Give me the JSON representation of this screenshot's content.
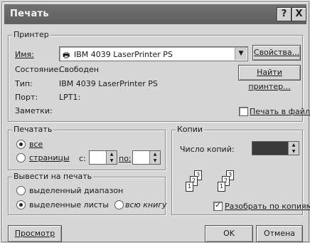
{
  "window": {
    "title": "Печать",
    "help_glyph": "?",
    "close_glyph": "X"
  },
  "printer": {
    "group_title": "Принтер",
    "name_label": "Имя:",
    "name_value": "IBM 4039 LaserPrinter PS",
    "properties_button": "Свойства...",
    "state_label": "Состояние:",
    "state_value": "Свободен",
    "find_button": "Найти принтер...",
    "type_label": "Тип:",
    "type_value": "IBM 4039 LaserPrinter PS",
    "port_label": "Порт:",
    "port_value": "LPT1:",
    "notes_label": "Заметки:",
    "print_to_file_label": "Печать в файл",
    "print_to_file_checked": false
  },
  "print_range": {
    "group_title": "Печатать",
    "all_label": "все",
    "all_selected": true,
    "pages_label": "страницы",
    "pages_selected": false,
    "from_label": "с:",
    "to_label": "по:",
    "from_value": "",
    "to_value": ""
  },
  "print_what": {
    "group_title": "Вывести на печать",
    "selection_label": "выделенный диапазон",
    "selection_selected": false,
    "sheets_label": "выделенные листы",
    "sheets_selected": true,
    "workbook_label": "всю книгу",
    "workbook_selected": false
  },
  "copies": {
    "group_title": "Копии",
    "count_label": "Число копий:",
    "count_value": "",
    "collate_label": "Разобрать по копиям",
    "collate_checked": true,
    "page_numbers": [
      "1",
      "2",
      "3"
    ]
  },
  "footer": {
    "preview_button": "Просмотр",
    "ok_button": "OK",
    "cancel_button": "Отмена"
  }
}
